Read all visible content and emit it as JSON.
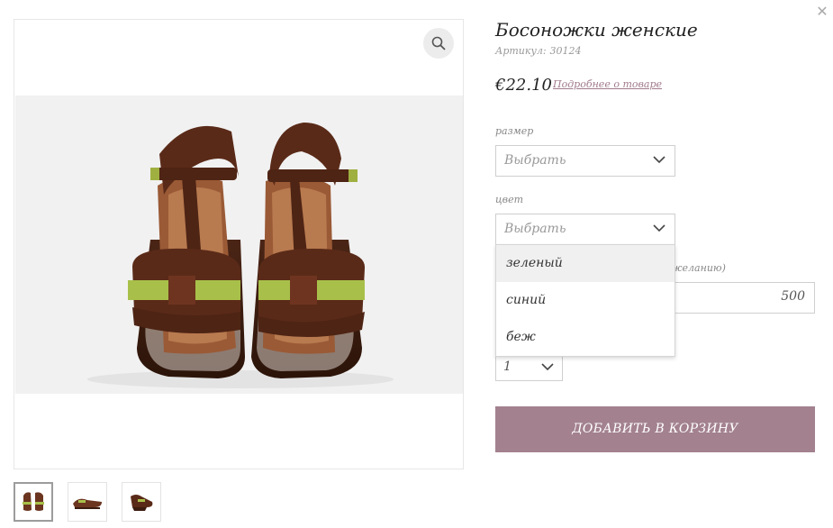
{
  "modal": {
    "close_icon": "close-icon"
  },
  "product": {
    "title": "Босоножки женские",
    "sku_label": "Артикул:",
    "sku_value": "30124",
    "price": "€22.10",
    "details_link": "Подробнее о товаре"
  },
  "size": {
    "label": "размер",
    "value": "Выбрать"
  },
  "color": {
    "label": "цвет",
    "value": "Выбрать",
    "options": [
      "зеленый",
      "синий",
      "беж"
    ],
    "hovered_option": 0
  },
  "engraving": {
    "label_partial": "желанию)",
    "value": "500"
  },
  "quantity": {
    "value": "1"
  },
  "add_to_cart": "ДОБАВИТЬ В КОРЗИНУ",
  "colors": {
    "accent": "#a3818f",
    "link": "#a07a8c"
  }
}
